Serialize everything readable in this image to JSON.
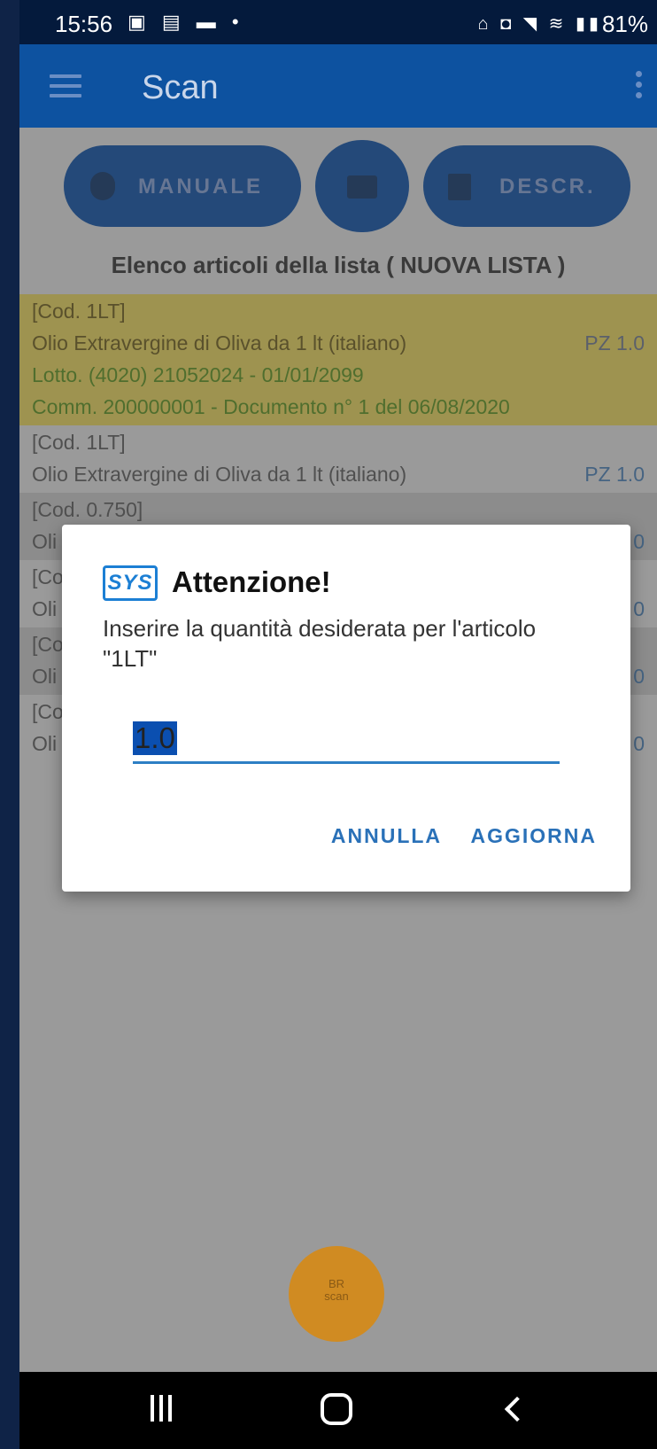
{
  "status_bar": {
    "time": "15:56",
    "left_icons": "▣ ▤ ▬ •",
    "right_icons": "⌂ ◘ ◥ ≋ ▮▮",
    "battery": "81%"
  },
  "app_bar": {
    "title": "Scan"
  },
  "toolbar": {
    "manuale_label": "MANUALE",
    "descr_label": "DESCR."
  },
  "list": {
    "heading": "Elenco articoli della lista ( NUOVA LISTA )",
    "items": [
      {
        "code": "[Cod. 1LT]",
        "description": "Olio Extravergine di Oliva da 1 lt (italiano)",
        "quantity": "PZ 1.0",
        "lot": "Lotto. (4020) 21052024 - 01/01/2099",
        "order": "Comm. 200000001 - Documento n° 1 del 06/08/2020"
      },
      {
        "code": "[Cod. 1LT]",
        "description": "Olio Extravergine di Oliva da 1 lt (italiano)",
        "quantity": "PZ 1.0"
      },
      {
        "code": "[Cod. 0.750]",
        "description": "Oli",
        "quantity": "0"
      },
      {
        "code": "[Co",
        "description": "Oli",
        "quantity": "0"
      },
      {
        "code": "[Co",
        "description": "Oli",
        "quantity": "0"
      },
      {
        "code": "[Co",
        "description": "Oli",
        "quantity": "0"
      }
    ]
  },
  "fab": {
    "label": "BR\nscan"
  },
  "dialog": {
    "logo_text": "SYS",
    "title": "Attenzione!",
    "message": "Inserire la quantità desiderata per l'articolo \"1LT\"",
    "input_value": "1.0",
    "cancel_label": "ANNULLA",
    "confirm_label": "AGGIORNA"
  }
}
